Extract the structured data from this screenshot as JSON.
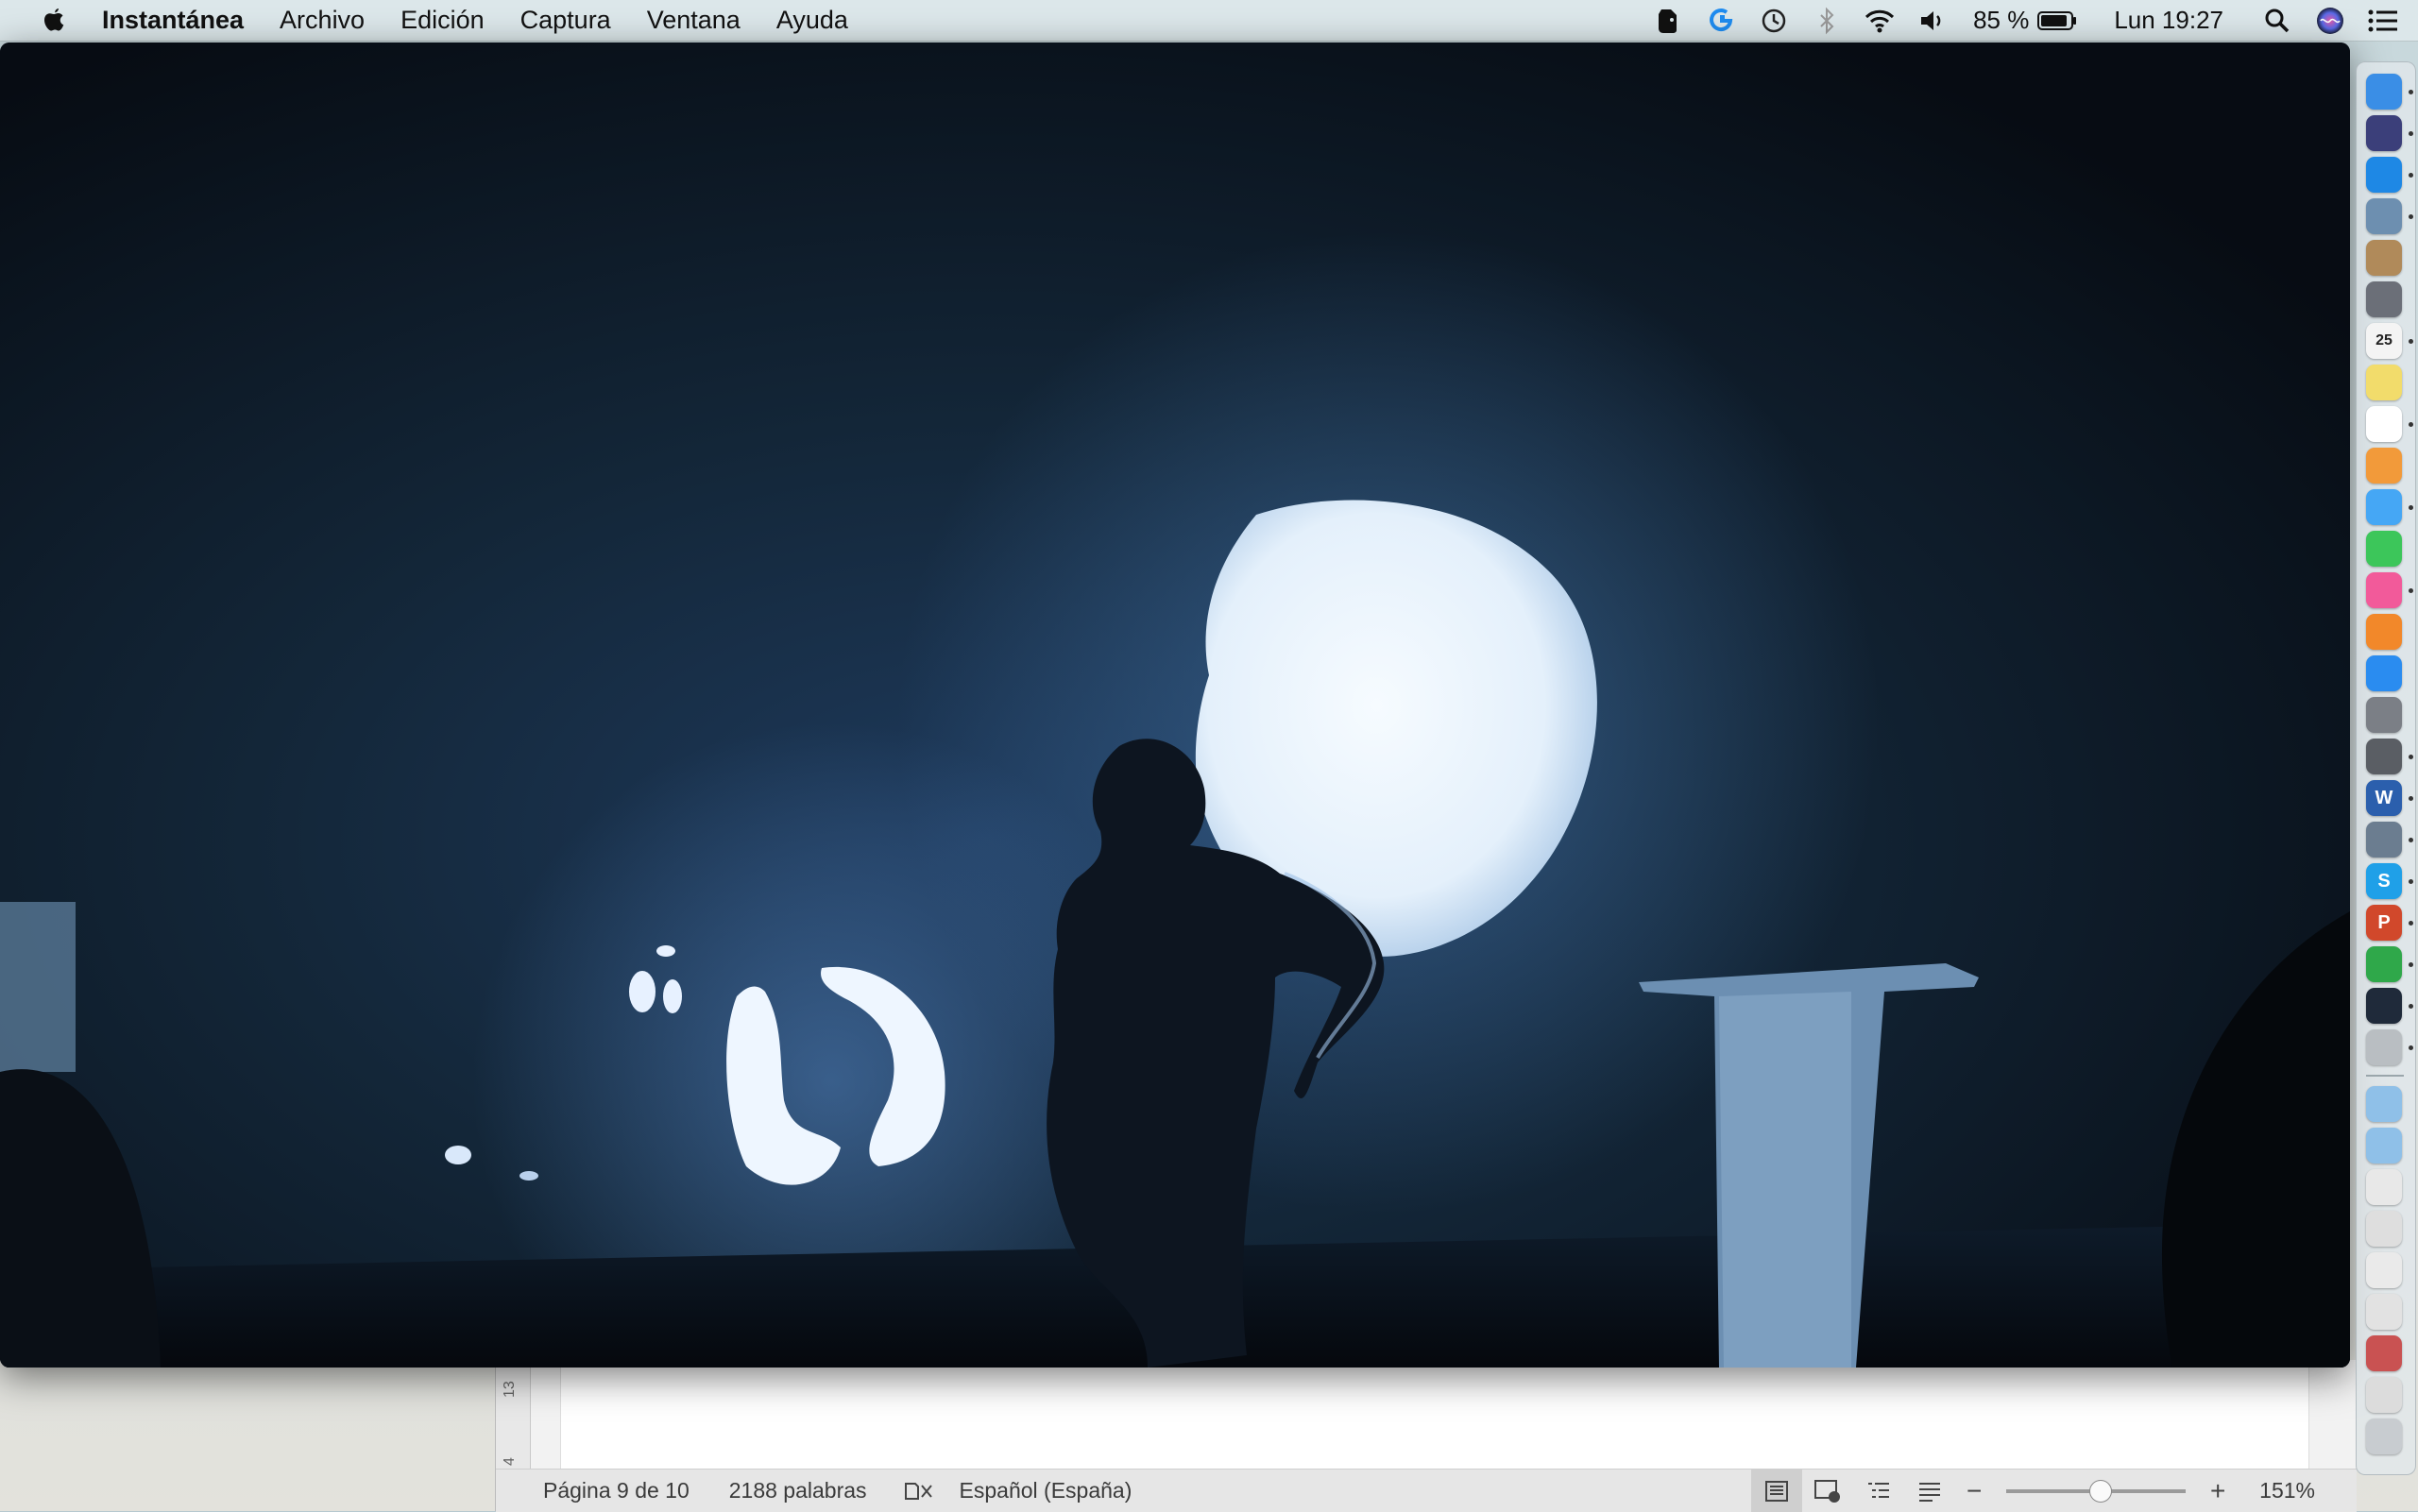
{
  "menubar": {
    "app_name": "Instantánea",
    "items": [
      "Archivo",
      "Edición",
      "Captura",
      "Ventana",
      "Ayuda"
    ],
    "battery": "85 %",
    "clock": "Lun 19:27",
    "status_icons": [
      "evernote-icon",
      "logitech-icon",
      "time-machine-icon",
      "bluetooth-icon",
      "wifi-icon",
      "volume-icon",
      "battery-icon",
      "spotlight-icon",
      "siri-icon",
      "notification-center-icon"
    ]
  },
  "word": {
    "ruler_marks": [
      "13",
      "4"
    ],
    "status": {
      "page": "Página 9 de 10",
      "words": "2188 palabras",
      "language": "Español (España)",
      "zoom": "151%",
      "zoom_value": 151
    }
  },
  "dock": {
    "apps": [
      {
        "name": "finder-icon",
        "color": "#3a8ee6",
        "label": "",
        "running": true
      },
      {
        "name": "siri-icon",
        "color": "#3b3f7a",
        "label": "",
        "running": true
      },
      {
        "name": "safari-icon",
        "color": "#1e88e5",
        "label": "",
        "running": true
      },
      {
        "name": "preview-icon",
        "color": "#6d8fb0",
        "label": "",
        "running": true
      },
      {
        "name": "contacts-icon",
        "color": "#b08a5a",
        "label": "",
        "running": false
      },
      {
        "name": "launchpad-icon",
        "color": "#6b6f78",
        "label": "",
        "running": false
      },
      {
        "name": "calendar-icon",
        "color": "#f4f4f4",
        "label": "25",
        "running": true
      },
      {
        "name": "notes-icon",
        "color": "#f2dc6b",
        "label": "",
        "running": false
      },
      {
        "name": "reminders-icon",
        "color": "#ffffff",
        "label": "",
        "running": true
      },
      {
        "name": "photos-icon",
        "color": "#f29a3a",
        "label": "",
        "running": false
      },
      {
        "name": "messages-icon",
        "color": "#45a7f5",
        "label": "",
        "running": true
      },
      {
        "name": "facetime-icon",
        "color": "#3cc65a",
        "label": "",
        "running": false
      },
      {
        "name": "itunes-icon",
        "color": "#f25a9a",
        "label": "",
        "running": true
      },
      {
        "name": "ibooks-icon",
        "color": "#f2882a",
        "label": "",
        "running": false
      },
      {
        "name": "app-store-icon",
        "color": "#2a8cf0",
        "label": "",
        "running": false
      },
      {
        "name": "system-preferences-icon",
        "color": "#7b7f86",
        "label": "",
        "running": false
      },
      {
        "name": "image-capture-icon",
        "color": "#5a5e64",
        "label": "",
        "running": true
      },
      {
        "name": "word-icon",
        "color": "#2b5fad",
        "label": "W",
        "running": true
      },
      {
        "name": "scanner-icon",
        "color": "#6b7d90",
        "label": "",
        "running": true
      },
      {
        "name": "skype-icon",
        "color": "#1fa0e8",
        "label": "S",
        "running": true
      },
      {
        "name": "powerpoint-icon",
        "color": "#d1482b",
        "label": "P",
        "running": true
      },
      {
        "name": "evernote-icon",
        "color": "#2fa84a",
        "label": "",
        "running": true
      },
      {
        "name": "quicktime-icon",
        "color": "#1f2a3a",
        "label": "",
        "running": true
      },
      {
        "name": "screenshot-icon",
        "color": "#b9bec2",
        "label": "",
        "running": true
      },
      {
        "name": "applications-folder-icon",
        "color": "#8fc0e8",
        "label": "",
        "running": false
      },
      {
        "name": "downloads-folder-icon",
        "color": "#8fc0e8",
        "label": "",
        "running": false
      },
      {
        "name": "document-stack-icon",
        "color": "#e8e8e8",
        "label": "",
        "running": false
      },
      {
        "name": "document-stack-icon",
        "color": "#dedede",
        "label": "",
        "running": false
      },
      {
        "name": "document-stack-icon",
        "color": "#eaeaea",
        "label": "",
        "running": false
      },
      {
        "name": "document-stack-icon",
        "color": "#e2e2e2",
        "label": "",
        "running": false
      },
      {
        "name": "document-stack-icon",
        "color": "#c95252",
        "label": "",
        "running": false
      },
      {
        "name": "document-stack-icon",
        "color": "#dcdcdc",
        "label": "",
        "running": false
      },
      {
        "name": "trash-icon",
        "color": "#c8ccd0",
        "label": "",
        "running": false
      }
    ]
  }
}
